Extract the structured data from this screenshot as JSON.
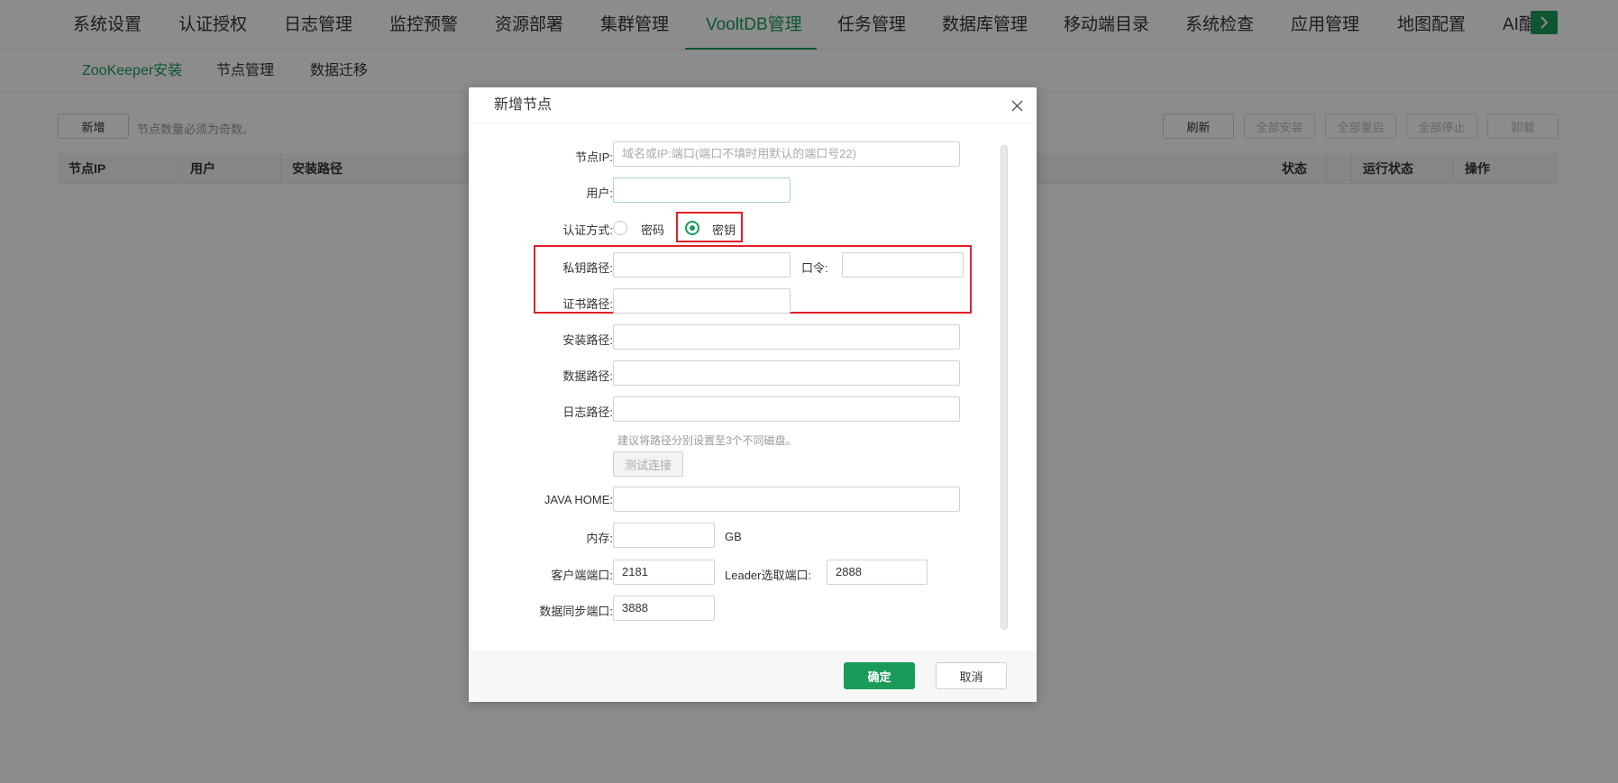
{
  "topnav": {
    "tabs": [
      {
        "label": "系统设置"
      },
      {
        "label": "认证授权"
      },
      {
        "label": "日志管理"
      },
      {
        "label": "监控预警"
      },
      {
        "label": "资源部署"
      },
      {
        "label": "集群管理"
      },
      {
        "label": "VooltDB管理"
      },
      {
        "label": "任务管理"
      },
      {
        "label": "数据库管理"
      },
      {
        "label": "移动端目录"
      },
      {
        "label": "系统检查"
      },
      {
        "label": "应用管理"
      },
      {
        "label": "地图配置"
      },
      {
        "label": "AI酯"
      }
    ],
    "active_tab": "VooltDB管理",
    "accent_color": "#1a9b5a",
    "more_icon": "chevron-right-icon"
  },
  "subnav": {
    "tabs": [
      {
        "label": "ZooKeeper安装"
      },
      {
        "label": "节点管理"
      },
      {
        "label": "数据迁移"
      }
    ],
    "active_tab": "ZooKeeper安装"
  },
  "toolbar": {
    "add_label": "新增",
    "hint": "节点数量必须为奇数。",
    "refresh_label": "刷新",
    "install_all_label": "全部安装",
    "restart_all_label": "全部重启",
    "stop_all_label": "全部停止",
    "uninstall_label": "卸载"
  },
  "table": {
    "columns": [
      "节点IP",
      "用户",
      "安装路径",
      "状态",
      "运行状态",
      "操作"
    ]
  },
  "modal": {
    "title": "新增节点",
    "close_icon": "close-icon",
    "fields": {
      "node_ip": {
        "label": "节点IP:",
        "value": "",
        "placeholder": "域名或IP:端口(端口不填时用默认的端口号22)"
      },
      "user": {
        "label": "用户:",
        "value": ""
      },
      "auth": {
        "label": "认证方式:",
        "options": [
          "密码",
          "密钥"
        ],
        "selected": "密钥"
      },
      "private_key_path": {
        "label": "私钥路径:",
        "value": ""
      },
      "passphrase": {
        "label": "口令:",
        "value": ""
      },
      "cert_path": {
        "label": "证书路径:",
        "value": ""
      },
      "install_path": {
        "label": "安装路径:",
        "value": ""
      },
      "data_path": {
        "label": "数据路径:",
        "value": ""
      },
      "log_path": {
        "label": "日志路径:",
        "value": ""
      },
      "path_hint": "建议将路径分别设置至3个不同磁盘。",
      "test_button": "测试连接",
      "java_home": {
        "label": "JAVA HOME:",
        "value": ""
      },
      "memory": {
        "label": "内存:",
        "value": "",
        "unit": "GB"
      },
      "client_port": {
        "label": "客户端端口:",
        "value": "2181"
      },
      "leader_port": {
        "label": "Leader选取端口:",
        "value": "2888"
      },
      "sync_port": {
        "label": "数据同步端口:",
        "value": "3888"
      }
    },
    "ok_label": "确定",
    "cancel_label": "取消",
    "highlight_color": "#e0202a"
  }
}
